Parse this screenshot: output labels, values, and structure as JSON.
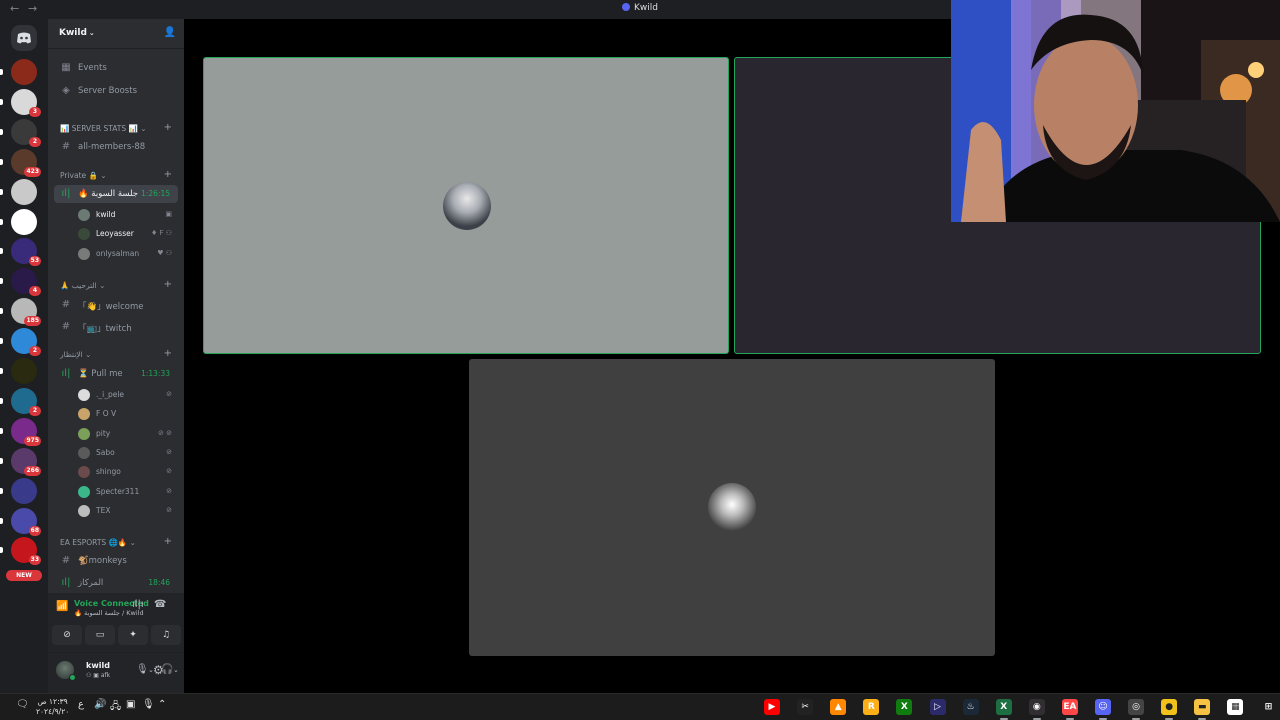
{
  "window": {
    "title": "Kwild",
    "back_glyph": "←",
    "forward_glyph": "→"
  },
  "rail": {
    "home_icon": "discord-logo-icon",
    "new_label": "NEW",
    "servers": [
      {
        "color": "#8b2a1a",
        "badge": ""
      },
      {
        "color": "#d9d9d9",
        "badge": "3"
      },
      {
        "color": "#3a3a3a",
        "badge": "2"
      },
      {
        "color": "#5a3a2a",
        "badge": "423"
      },
      {
        "color": "#c9c9c9",
        "badge": ""
      },
      {
        "color": "#ffffff",
        "badge": ""
      },
      {
        "color": "#3a2a7a",
        "badge": "53"
      },
      {
        "color": "#2a1a4a",
        "badge": "4"
      },
      {
        "color": "#b8b8b8",
        "badge": "185"
      },
      {
        "color": "#2e89d8",
        "badge": "2"
      },
      {
        "color": "#2a2a10",
        "badge": ""
      },
      {
        "color": "#1e6b8f",
        "badge": "2"
      },
      {
        "color": "#7a2a8a",
        "badge": "975"
      },
      {
        "color": "#5a3a6a",
        "badge": "266"
      },
      {
        "color": "#3a3a8a",
        "badge": ""
      },
      {
        "color": "#4a4aaa",
        "badge": "68"
      },
      {
        "color": "#c4161c",
        "badge": "33"
      }
    ]
  },
  "sidebar": {
    "server_name": "Kwild",
    "items": [
      {
        "icon": "calendar-icon",
        "label": "Events"
      },
      {
        "icon": "boost-icon",
        "label": "Server Boosts"
      }
    ],
    "categories": {
      "server_stats": "📊 SERVER STATS 📊",
      "private": "Private 🔒",
      "welcome": "🙏 الترحيب",
      "waiting": "الإنتظار",
      "ea": "EA ESPORTS 🌐🔥"
    },
    "channels": {
      "all_members": "all-members-88",
      "session": "🔥 جلسة السوبة",
      "session_timer": "1:26:15",
      "welcome": "「👋」welcome",
      "twitch": "「📺」twitch",
      "pull_me": "⏳ Pull me",
      "pull_timer": "1:13:33",
      "monkeys": "🐒monkeys",
      "center": "المركاز",
      "center_timer": "18:46"
    },
    "session_users": [
      {
        "name": "kwild",
        "status": "▣",
        "color": "#6b7a73"
      },
      {
        "name": "Leoyasser",
        "status": "♦ F ⚇",
        "color": "#3a4a3a"
      },
      {
        "name": "onlysalman",
        "status": "♥ ⚇",
        "color": "#7a7a7a"
      }
    ],
    "pull_users": [
      {
        "name": "._i_pele",
        "status": "⊘",
        "color": "#dcdcdc"
      },
      {
        "name": "F O V",
        "status": "",
        "color": "#c9a46a"
      },
      {
        "name": "pity",
        "status": "⊘ ⊘",
        "color": "#7aa05a"
      },
      {
        "name": "Sabo",
        "status": "⊘",
        "color": "#5a5a5a"
      },
      {
        "name": "shingo",
        "status": "⊘",
        "color": "#6a4a4a"
      },
      {
        "name": "Specter311",
        "status": "⊘",
        "color": "#3ab88a"
      },
      {
        "name": "TEX",
        "status": "⊘",
        "color": "#bcbcbc"
      }
    ]
  },
  "voice": {
    "title": "Voice Connected",
    "subtitle": "🔥 جلسة السوبة / Kwild"
  },
  "user": {
    "name": "kwild",
    "status": "⚇ ▣ afk"
  },
  "stage": {
    "tiles": [
      {
        "bg": "#959c99",
        "border": "#23a55a",
        "avatar": "#4a4e57"
      },
      {
        "bg": "#2a2630",
        "border": "#23a55a",
        "avatar": ""
      },
      {
        "bg": "#404040",
        "border": "",
        "avatar": "#cfcfcf"
      }
    ]
  },
  "taskbar": {
    "time": "١٢:٣٩ ص",
    "date": "٢٠٢٤/٩/٢٠",
    "lang": "ع",
    "apps": [
      {
        "icon": "youtube-icon",
        "color": "#ff0000",
        "glyph": "▶"
      },
      {
        "icon": "capcut-icon",
        "color": "#222222",
        "glyph": "✂"
      },
      {
        "icon": "vlc-icon",
        "color": "#ff8800",
        "glyph": "▲"
      },
      {
        "icon": "rockstar-icon",
        "color": "#fcaf17",
        "glyph": "R"
      },
      {
        "icon": "xbox-icon",
        "color": "#107c10",
        "glyph": "X"
      },
      {
        "icon": "media-icon",
        "color": "#2b2b6b",
        "glyph": "▷"
      },
      {
        "icon": "steam-icon",
        "color": "#1b2838",
        "glyph": "♨"
      },
      {
        "icon": "excel-icon",
        "color": "#1d6f42",
        "glyph": "X"
      },
      {
        "icon": "obs-icon",
        "color": "#302e31",
        "glyph": "◉"
      },
      {
        "icon": "ea-icon",
        "color": "#ff4747",
        "glyph": "EA"
      },
      {
        "icon": "discord-icon",
        "color": "#5865f2",
        "glyph": "☺"
      },
      {
        "icon": "obs-studio-icon",
        "color": "#444444",
        "glyph": "◎"
      },
      {
        "icon": "chrome-icon",
        "color": "#f2c21a",
        "glyph": "●"
      },
      {
        "icon": "file-explorer-icon",
        "color": "#f6c244",
        "glyph": "▬"
      },
      {
        "icon": "calendar-app-icon",
        "color": "#ffffff",
        "glyph": "▦"
      },
      {
        "icon": "windows-start-icon",
        "color": "#1c1c1c",
        "glyph": "⊞"
      }
    ]
  }
}
